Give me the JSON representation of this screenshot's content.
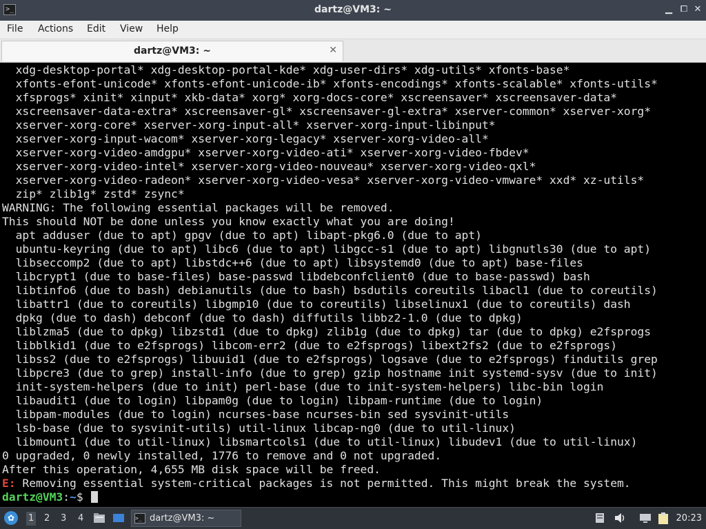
{
  "window": {
    "title": "dartz@VM3: ~",
    "terminal_icon_glyph": ">_",
    "minimize_glyph": "▁",
    "maximize_glyph": "⧠",
    "close_glyph": "✕"
  },
  "menu": [
    "File",
    "Actions",
    "Edit",
    "View",
    "Help"
  ],
  "tab": {
    "label": "dartz@VM3: ~",
    "close_glyph": "✕"
  },
  "terminal": {
    "lines": [
      "  xdg-desktop-portal* xdg-desktop-portal-kde* xdg-user-dirs* xdg-utils* xfonts-base*",
      "  xfonts-efont-unicode* xfonts-efont-unicode-ib* xfonts-encodings* xfonts-scalable* xfonts-utils*",
      "  xfsprogs* xinit* xinput* xkb-data* xorg* xorg-docs-core* xscreensaver* xscreensaver-data*",
      "  xscreensaver-data-extra* xscreensaver-gl* xscreensaver-gl-extra* xserver-common* xserver-xorg*",
      "  xserver-xorg-core* xserver-xorg-input-all* xserver-xorg-input-libinput*",
      "  xserver-xorg-input-wacom* xserver-xorg-legacy* xserver-xorg-video-all*",
      "  xserver-xorg-video-amdgpu* xserver-xorg-video-ati* xserver-xorg-video-fbdev*",
      "  xserver-xorg-video-intel* xserver-xorg-video-nouveau* xserver-xorg-video-qxl*",
      "  xserver-xorg-video-radeon* xserver-xorg-video-vesa* xserver-xorg-video-vmware* xxd* xz-utils*",
      "  zip* zlib1g* zstd* zsync*",
      "WARNING: The following essential packages will be removed.",
      "This should NOT be done unless you know exactly what you are doing!",
      "  apt adduser (due to apt) gpgv (due to apt) libapt-pkg6.0 (due to apt)",
      "  ubuntu-keyring (due to apt) libc6 (due to apt) libgcc-s1 (due to apt) libgnutls30 (due to apt)",
      "  libseccomp2 (due to apt) libstdc++6 (due to apt) libsystemd0 (due to apt) base-files",
      "  libcrypt1 (due to base-files) base-passwd libdebconfclient0 (due to base-passwd) bash",
      "  libtinfo6 (due to bash) debianutils (due to bash) bsdutils coreutils libacl1 (due to coreutils)",
      "  libattr1 (due to coreutils) libgmp10 (due to coreutils) libselinux1 (due to coreutils) dash",
      "  dpkg (due to dash) debconf (due to dash) diffutils libbz2-1.0 (due to dpkg)",
      "  liblzma5 (due to dpkg) libzstd1 (due to dpkg) zlib1g (due to dpkg) tar (due to dpkg) e2fsprogs",
      "  libblkid1 (due to e2fsprogs) libcom-err2 (due to e2fsprogs) libext2fs2 (due to e2fsprogs)",
      "  libss2 (due to e2fsprogs) libuuid1 (due to e2fsprogs) logsave (due to e2fsprogs) findutils grep",
      "  libpcre3 (due to grep) install-info (due to grep) gzip hostname init systemd-sysv (due to init)",
      "  init-system-helpers (due to init) perl-base (due to init-system-helpers) libc-bin login",
      "  libaudit1 (due to login) libpam0g (due to login) libpam-runtime (due to login)",
      "  libpam-modules (due to login) ncurses-base ncurses-bin sed sysvinit-utils",
      "  lsb-base (due to sysvinit-utils) util-linux libcap-ng0 (due to util-linux)",
      "  libmount1 (due to util-linux) libsmartcols1 (due to util-linux) libudev1 (due to util-linux)",
      "0 upgraded, 0 newly installed, 1776 to remove and 0 not upgraded.",
      "After this operation, 4,655 MB disk space will be freed."
    ],
    "error_prefix": "E:",
    "error_text": " Removing essential system-critical packages is not permitted. This might break the system.",
    "prompt_user": "dartz@VM3",
    "prompt_sep": ":",
    "prompt_path": "~",
    "prompt_symbol": "$ "
  },
  "taskbar": {
    "start_glyph": "✿",
    "workspaces": [
      "1",
      "2",
      "3",
      "4"
    ],
    "active_workspace": "1",
    "quicklaunch_icons": [
      "file-manager-icon",
      "show-desktop-icon"
    ],
    "task_label": "dartz@VM3: ~",
    "tray_icons": [
      "network-icon",
      "volume-icon",
      "display-icon",
      "clipboard-icon"
    ],
    "clock": "20:23"
  },
  "colors": {
    "titlebar": "#3d4450",
    "terminal_bg": "#000000",
    "terminal_fg": "#e0e0e0",
    "prompt_user": "#55d35c",
    "prompt_path": "#4f8ff0",
    "error": "#e0463c",
    "taskbar": "#2e333a"
  }
}
